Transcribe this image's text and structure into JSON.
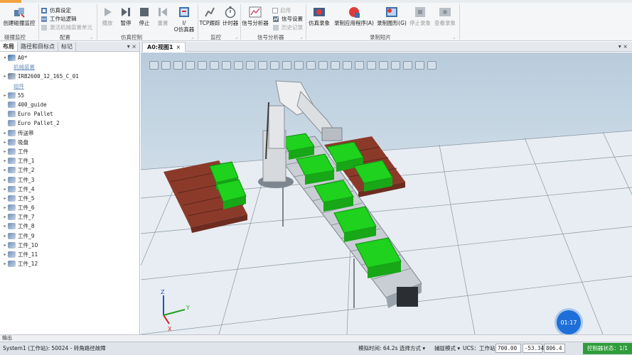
{
  "ribbon": {
    "groups": {
      "collision": "碰撞监控",
      "config": "配置",
      "sim_control": "仿真控制",
      "monitor": "监控",
      "signal_analyzer": "信号分析器",
      "record_clip": "录制短片"
    },
    "create_collision_monitor": "创建碰撞监控",
    "sim_settings": "仿真设定",
    "station_logic": "工作站逻辑",
    "activate_mech_unit": "激活机械装置单元",
    "play": "播放",
    "pause": "暂停",
    "stop": "停止",
    "reset": "重置",
    "io_simulator_l1": "I/",
    "io_simulator_l2": "O仿真器",
    "tcp_trace": "TCP跟踪",
    "timer": "计时器",
    "signal_analyzer_btn": "信号分析器",
    "enable": "启用",
    "signal_settings": "信号设置",
    "history": "历史记录",
    "sim_record": "仿真录象",
    "record_app": "录制应用程序(A)",
    "record_graphics": "录制图形(G)",
    "stop_record": "停止录象",
    "view_record": "查看录象"
  },
  "left_panel": {
    "tabs": [
      "布局",
      "路径和目标点",
      "标记"
    ],
    "controls": "▾ ×",
    "tree": [
      {
        "label": "A0*",
        "kind": "station",
        "expand": "▾"
      },
      {
        "label": "机械装置",
        "kind": "header",
        "expand": ""
      },
      {
        "label": "IRB2600_12_165_C_01",
        "kind": "robot",
        "expand": "▸"
      },
      {
        "label": "组件",
        "kind": "header",
        "expand": ""
      },
      {
        "label": "55",
        "kind": "part",
        "expand": "▸"
      },
      {
        "label": "400_guide",
        "kind": "part",
        "expand": ""
      },
      {
        "label": "Euro Pallet",
        "kind": "part",
        "expand": ""
      },
      {
        "label": "Euro Pallet_2",
        "kind": "part",
        "expand": ""
      },
      {
        "label": "传送带",
        "kind": "part",
        "expand": "▸"
      },
      {
        "label": "吸盘",
        "kind": "part",
        "expand": "▸"
      },
      {
        "label": "工件",
        "kind": "part",
        "expand": "▸"
      },
      {
        "label": "工件_1",
        "kind": "part",
        "expand": "▸"
      },
      {
        "label": "工件_2",
        "kind": "part",
        "expand": "▸"
      },
      {
        "label": "工件_3",
        "kind": "part",
        "expand": "▸"
      },
      {
        "label": "工件_4",
        "kind": "part",
        "expand": "▸"
      },
      {
        "label": "工件_5",
        "kind": "part",
        "expand": "▸"
      },
      {
        "label": "工件_6",
        "kind": "part",
        "expand": "▸"
      },
      {
        "label": "工件_7",
        "kind": "part",
        "expand": "▸"
      },
      {
        "label": "工件_8",
        "kind": "part",
        "expand": "▸"
      },
      {
        "label": "工件_9",
        "kind": "part",
        "expand": "▸"
      },
      {
        "label": "工件_10",
        "kind": "part",
        "expand": "▸"
      },
      {
        "label": "工件_11",
        "kind": "part",
        "expand": "▸"
      },
      {
        "label": "工件_12",
        "kind": "part",
        "expand": "▸"
      }
    ]
  },
  "viewport": {
    "tab": "A0:视图1",
    "tab_close": "×",
    "controls": "▾ ×",
    "axis_x": "X",
    "axis_y": "Y",
    "axis_z": "Z",
    "time_badge": "01:17"
  },
  "output_strip": "输出",
  "status_bar": {
    "message": "System1 (工作站): 50024 - 转角路径故障",
    "sim_time": "模拟时间: 64.2s",
    "select_mode": "选择方式",
    "capture_mode": "捕捉模式",
    "ucs": "UCS：工作站",
    "x": "700.00",
    "y": "-53.34",
    "z": "806.4",
    "controller_status": "控制器状态：1/1"
  },
  "colors": {
    "accent_orange": "#f3a33d",
    "box_green": "#1ed21e",
    "pallet_brown": "#8b3a2a",
    "controller_green": "#2f9c3a",
    "time_badge_blue": "#1e6fd9"
  }
}
